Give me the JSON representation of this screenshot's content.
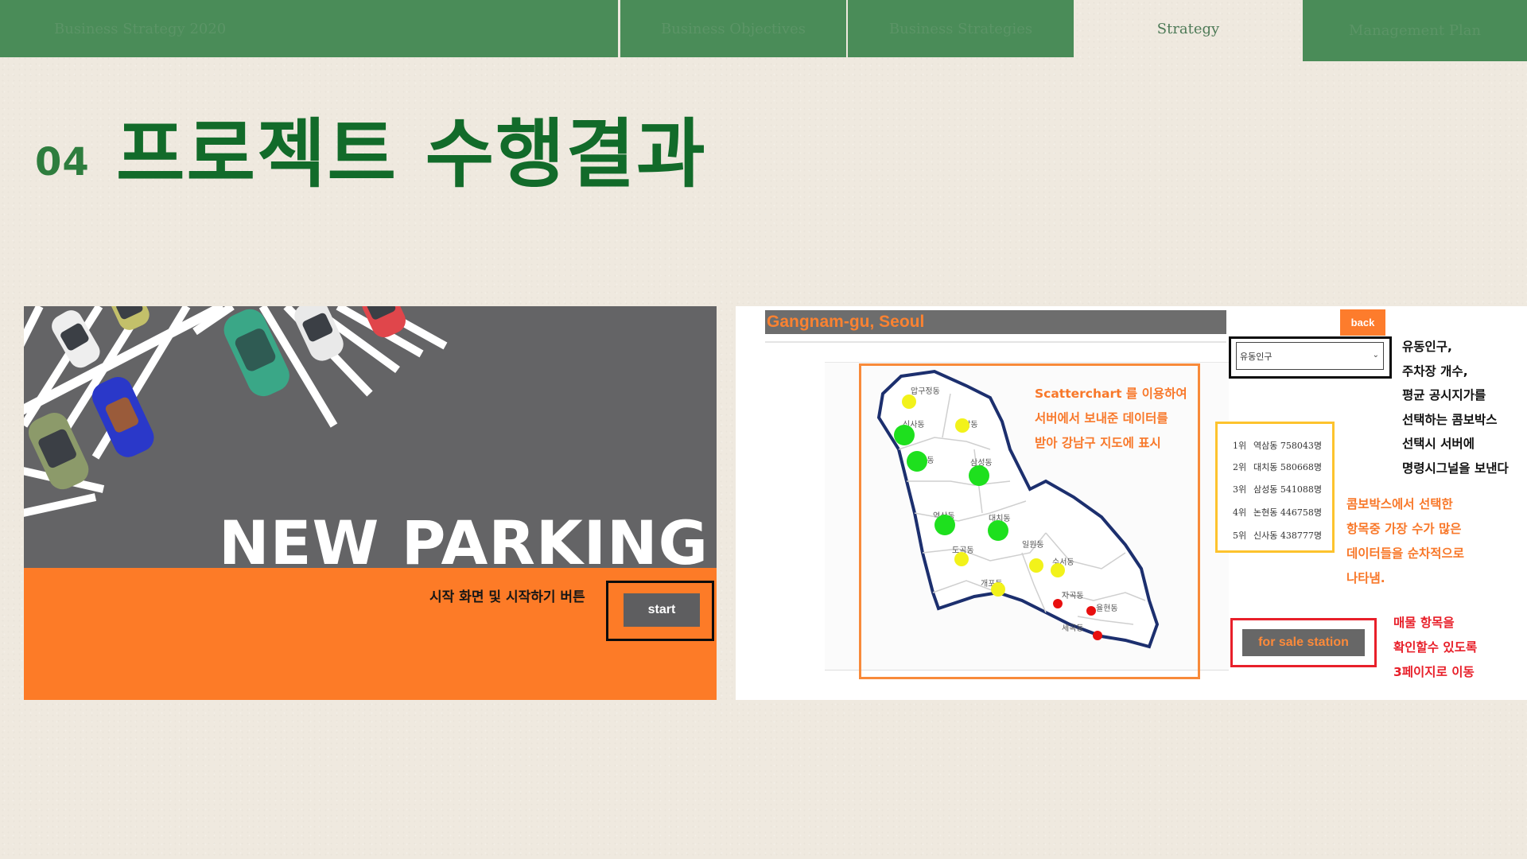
{
  "tabs": [
    {
      "label": "Business Strategy 2020"
    },
    {
      "label": "Business Objectives"
    },
    {
      "label": "Business Strategies"
    },
    {
      "label": "Strategy"
    },
    {
      "label": "Management Plan"
    }
  ],
  "heading": {
    "number": "04",
    "title": "프로젝트 수행결과"
  },
  "start_screen": {
    "brand": "NEW PARKING",
    "caption": "시작 화면 및 시작하기 버튼",
    "start_label": "start"
  },
  "map_screen": {
    "header": "Gangnam-gu, Seoul",
    "back_label": "back",
    "combo_value": "유동인구",
    "combo_note": [
      "유동인구,",
      "주차장 개수,",
      "평균 공시지가를",
      "선택하는 콤보박스",
      "선택시 서버에",
      "명령시그널을 보낸다"
    ],
    "map_note": [
      "Scatterchart 를 이용하여",
      "서버에서 보내준 데이터를",
      "받아 강남구 지도에 표시"
    ],
    "ranking": [
      {
        "rank": "1위",
        "text": "역삼동 758043명"
      },
      {
        "rank": "2위",
        "text": "대치동 580668명"
      },
      {
        "rank": "3위",
        "text": "삼성동 541088명"
      },
      {
        "rank": "4위",
        "text": "논현동 446758명"
      },
      {
        "rank": "5위",
        "text": "신사동 438777명"
      }
    ],
    "ranking_note": [
      "콤보박스에서 선택한",
      "항목중 가장 수가 많은",
      "데이터들을 순차적으로",
      "나타냄."
    ],
    "sale_label": "for sale station",
    "sale_note": [
      "매물 항목을",
      "확인할수 있도록",
      "3페이지로 이동"
    ],
    "districts": {
      "apgujeong": "압구정동",
      "sinsa": "신사동",
      "cheongdam": "청담동",
      "nonhyeon": "논현동",
      "samseong": "삼성동",
      "yeoksam": "역삼동",
      "daechi": "대치동",
      "dogok": "도곡동",
      "irwon": "일원동",
      "suseo": "수서동",
      "gaepo": "개포동",
      "jagok": "자곡동",
      "yulhyeon": "율현동",
      "segok": "세곡동"
    },
    "dot_colors": {
      "high": "#1ee01e",
      "mid": "#f2f21a",
      "low": "#e80f0f"
    }
  }
}
